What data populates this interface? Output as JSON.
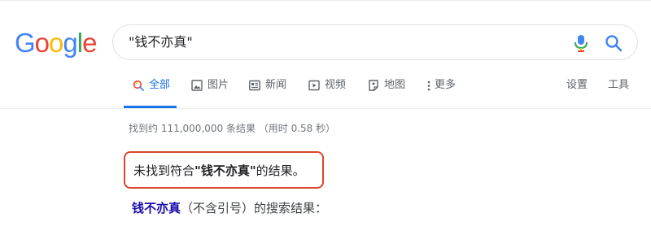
{
  "logo": {
    "letters": [
      "G",
      "o",
      "o",
      "g",
      "l",
      "e"
    ],
    "colors": [
      "#4285f4",
      "#ea4335",
      "#fbbc05",
      "#4285f4",
      "#34a853",
      "#ea4335"
    ]
  },
  "search": {
    "query": "\"钱不亦真\"",
    "mic_icon": "mic-icon",
    "search_icon": "search-icon"
  },
  "tabs": [
    {
      "label": "全部",
      "icon": "search-icon",
      "active": true
    },
    {
      "label": "图片",
      "icon": "image-icon",
      "active": false
    },
    {
      "label": "新闻",
      "icon": "news-icon",
      "active": false
    },
    {
      "label": "视频",
      "icon": "video-icon",
      "active": false
    },
    {
      "label": "地图",
      "icon": "map-icon",
      "active": false
    },
    {
      "label": "更多",
      "icon": "more-vert-icon",
      "active": false
    }
  ],
  "tools": {
    "settings_label": "设置",
    "tools_label": "工具"
  },
  "results": {
    "stats": "找到约 111,000,000 条结果 （用时 0.58 秒）",
    "no_results_prefix": "未找到符合",
    "no_results_query": "\"钱不亦真\"",
    "no_results_suffix": "的结果。",
    "alt_query_link": "钱不亦真",
    "alt_query_suffix": "（不含引号）的搜索结果："
  },
  "colors": {
    "accent": "#1a73e8",
    "link": "#1a0dab",
    "highlight_border": "#d9452f"
  }
}
